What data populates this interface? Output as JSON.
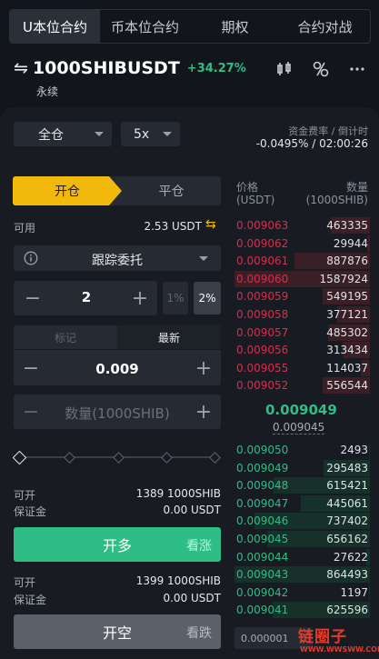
{
  "tabs": [
    "U本位合约",
    "币本位合约",
    "期权",
    "合约对战"
  ],
  "header": {
    "symbol": "1000SHIBUSDT",
    "change": "+34.27%",
    "type": "永续"
  },
  "controls": {
    "margin_mode": "全仓",
    "leverage": "5x",
    "funding_label": "资金费率 / 倒计时",
    "funding_value": "-0.0495% / 02:00:26"
  },
  "order_tabs": {
    "open": "开仓",
    "close": "平仓"
  },
  "available": {
    "label": "可用",
    "value": "2.53 USDT"
  },
  "order_type": "跟踪委托",
  "callback": {
    "value": "2",
    "pct1": "1%",
    "pct2": "2%"
  },
  "price_tabs": {
    "mark": "标记",
    "last": "最新"
  },
  "trigger_price": "0.009",
  "quantity_placeholder": "数量(1000SHIB)",
  "slider": {
    "level_percent": 0
  },
  "long": {
    "can_open_label": "可开",
    "can_open_value": "1389 1000SHIB",
    "margin_label": "保证金",
    "margin_value": "0.00 USDT",
    "button": "开多",
    "sub": "看涨"
  },
  "short": {
    "can_open_label": "可开",
    "can_open_value": "1399 1000SHIB",
    "margin_label": "保证金",
    "margin_value": "0.00 USDT",
    "button": "开空",
    "sub": "看跌"
  },
  "orderbook": {
    "price_label": "价格",
    "price_unit": "(USDT)",
    "qty_label": "数量",
    "qty_unit": "(1000SHIB)",
    "asks": [
      {
        "price": "0.009063",
        "qty": "463335",
        "depth": 0.29
      },
      {
        "price": "0.009062",
        "qty": "29944",
        "depth": 0.02
      },
      {
        "price": "0.009061",
        "qty": "887876",
        "depth": 0.56
      },
      {
        "price": "0.009060",
        "qty": "1587924",
        "depth": 1.0
      },
      {
        "price": "0.009059",
        "qty": "549195",
        "depth": 0.35
      },
      {
        "price": "0.009058",
        "qty": "377121",
        "depth": 0.24
      },
      {
        "price": "0.009057",
        "qty": "485302",
        "depth": 0.31
      },
      {
        "price": "0.009056",
        "qty": "313434",
        "depth": 0.2
      },
      {
        "price": "0.009055",
        "qty": "114037",
        "depth": 0.07
      },
      {
        "price": "0.009052",
        "qty": "556544",
        "depth": 0.35
      }
    ],
    "last_price": "0.009049",
    "mark_price": "0.009045",
    "bids": [
      {
        "price": "0.009050",
        "qty": "2493",
        "depth": 0.003
      },
      {
        "price": "0.009049",
        "qty": "295483",
        "depth": 0.34
      },
      {
        "price": "0.009048",
        "qty": "615421",
        "depth": 0.71
      },
      {
        "price": "0.009047",
        "qty": "445061",
        "depth": 0.51
      },
      {
        "price": "0.009046",
        "qty": "737402",
        "depth": 0.85
      },
      {
        "price": "0.009045",
        "qty": "656162",
        "depth": 0.76
      },
      {
        "price": "0.009044",
        "qty": "27622",
        "depth": 0.03
      },
      {
        "price": "0.009043",
        "qty": "864493",
        "depth": 1.0
      },
      {
        "price": "0.009042",
        "qty": "1197",
        "depth": 0.002
      },
      {
        "price": "0.009041",
        "qty": "625596",
        "depth": 0.72
      }
    ],
    "depth_step": "0.000001"
  },
  "watermark": {
    "brand": "链圈子",
    "site": "WWW.WWSWW.COM"
  },
  "colors": {
    "accent": "#f0b90b",
    "up": "#2ebd85",
    "down": "#e0294a"
  }
}
